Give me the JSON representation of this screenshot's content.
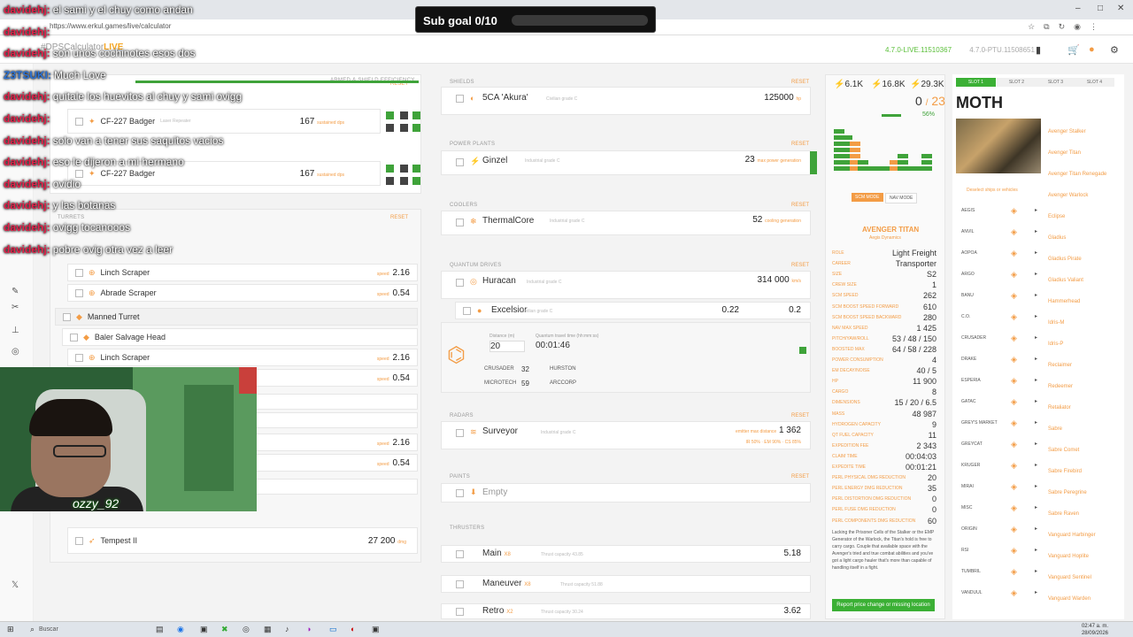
{
  "browser": {
    "url": "https://www.erkul.games/live/calculator",
    "window_controls": [
      "–",
      "□",
      "✕"
    ]
  },
  "site": {
    "logo_text": "#DPSCalculator",
    "logo_highlight": "LIVE",
    "live_label": "4.7.0-LIVE.11510367",
    "ptu_label": "4.7.0-PTU.11508651"
  },
  "subgoal": {
    "label": "Sub goal 0/10"
  },
  "chat": [
    {
      "user": "davidehj:",
      "msg": "el sami y el chuy como andan",
      "color": "red"
    },
    {
      "user": "davidehj:",
      "msg": "",
      "color": "red"
    },
    {
      "user": "davidehj:",
      "msg": "son unos cochinotes esos dos",
      "color": "red"
    },
    {
      "user": "Z3TSUKI:",
      "msg": "Much Love",
      "color": "blue"
    },
    {
      "user": "davidehj:",
      "msg": "quitale los huevitos al chuy y sami ovigg",
      "color": "red"
    },
    {
      "user": "davidehj:",
      "msg": "",
      "color": "red"
    },
    {
      "user": "davidehj:",
      "msg": "solo van a tener sus saquitos vacios",
      "color": "red"
    },
    {
      "user": "davidehj:",
      "msg": "eso le dijeron a mi hermano",
      "color": "red"
    },
    {
      "user": "davidehj:",
      "msg": "ovidio",
      "color": "red"
    },
    {
      "user": "davidehj:",
      "msg": "y las botanas",
      "color": "red"
    },
    {
      "user": "davidehj:",
      "msg": "ovigg tocanooos",
      "color": "red"
    },
    {
      "user": "davidehj:",
      "msg": "pobre ovig otra vez a leer",
      "color": "red"
    }
  ],
  "webcam": {
    "tag": "ozzy_92"
  },
  "weapons": {
    "header": "ARMED & SHIELD EFFICIENCY",
    "reset": "RESET",
    "rows": [
      {
        "name": "CF-227 Badger",
        "sub": "Laser Repeater",
        "value": "167",
        "unit": "sustained dps"
      },
      {
        "name": "CF-227 Badger",
        "sub": "",
        "value": "167",
        "unit": "sustained dps"
      }
    ]
  },
  "turrets": {
    "header": "TURRETS",
    "reset": "RESET",
    "rows": [
      {
        "name": "Linch Scraper",
        "value": "2.16",
        "unit": "speed"
      },
      {
        "name": "Abrade Scraper",
        "value": "0.54",
        "unit": "speed"
      },
      {
        "name": "Manned Turret",
        "value": "",
        "unit": ""
      },
      {
        "name": "Baler Salvage Head",
        "value": "",
        "unit": ""
      },
      {
        "name": "Linch Scraper",
        "value": "2.16",
        "unit": "speed"
      },
      {
        "name": "",
        "value": "0.54",
        "unit": "speed"
      },
      {
        "name": "",
        "value": "2.16",
        "unit": "speed"
      },
      {
        "name": "",
        "value": "0.54",
        "unit": "speed"
      },
      {
        "name": "Tempest II",
        "value": "27 200",
        "unit": "dmg"
      }
    ]
  },
  "shields": {
    "header": "SHIELDS",
    "reset": "RESET",
    "name": "5CA 'Akura'",
    "sub": "Civilian grade C",
    "value": "125000",
    "unit": "hp"
  },
  "power": {
    "header": "POWER PLANTS",
    "reset": "RESET",
    "name": "Ginzel",
    "sub": "Industrial grade C",
    "value": "23",
    "unit": "max power generation"
  },
  "coolers": {
    "header": "COOLERS",
    "reset": "RESET",
    "name": "ThermalCore",
    "sub": "Industrial grade C",
    "value": "52",
    "unit": "cooling generation"
  },
  "quantum": {
    "header": "QUANTUM DRIVES",
    "reset": "RESET",
    "name": "Huracan",
    "sub": "Industrial grade C",
    "value": "314 000",
    "unit": "km/s",
    "sub_name": "Excelsior",
    "sub_sub": "Civilian grade C",
    "sub_val1": "0.22",
    "sub_val2": "0.2",
    "distance_label": "Distance (m)",
    "distance": "20",
    "travel_label": "Quantum travel time (hh:mm:ss)",
    "travel": "00:01:46",
    "route": [
      {
        "from": "CRUSADER",
        "km": "32",
        "to": "HURSTON"
      },
      {
        "from": "MICROTECH",
        "km": "59",
        "to": "ARCCORP"
      }
    ]
  },
  "radars": {
    "header": "RADARS",
    "reset": "RESET",
    "name": "Surveyor",
    "sub": "Industrial grade C",
    "value": "1 362",
    "unit": "emitter max distance",
    "pcts": "IR 50% · EM 90% · CS 85%"
  },
  "paints": {
    "header": "PAINTS",
    "reset": "RESET",
    "name": "Empty"
  },
  "thrusters": {
    "header": "THRUSTERS",
    "rows": [
      {
        "name": "Main",
        "mult": "X8",
        "sub": "Thrust capacity 43.85",
        "value": "5.18"
      },
      {
        "name": "Maneuver",
        "mult": "X8",
        "sub": "Thrust capacity 51.88",
        "value": ""
      },
      {
        "name": "Retro",
        "mult": "X2",
        "sub": "Thrust capacity 30.24",
        "value": "3.62"
      }
    ]
  },
  "stats": {
    "top": [
      {
        "val": "6.1K"
      },
      {
        "val": "16.8K"
      },
      {
        "val": "29.3K"
      }
    ],
    "output": "0",
    "output_max": "23",
    "consumption_pct": "56",
    "mode_scm": "SCM MODE",
    "mode_nav": "NAV MODE",
    "ship_title": "AVENGER TITAN",
    "ship_sub": "Aegis Dynamics",
    "specs": [
      {
        "label": "ROLE",
        "value": "Light Freight"
      },
      {
        "label": "CAREER",
        "value": "Transporter"
      },
      {
        "label": "SIZE",
        "value": "S2"
      },
      {
        "label": "CREW SIZE",
        "value": "1"
      },
      {
        "label": "SCM SPEED",
        "value": "262"
      },
      {
        "label": "SCM BOOST SPEED FORWARD",
        "value": "610"
      },
      {
        "label": "SCM BOOST SPEED BACKWARD",
        "value": "280"
      },
      {
        "label": "NAV MAX SPEED",
        "value": "1 425"
      },
      {
        "label": "PITCH/YAW/ROLL",
        "value": "53 / 48 / 150"
      },
      {
        "label": "BOOSTED MAX",
        "value": "64 / 58 / 228"
      },
      {
        "label": "POWER CONSUMPTION",
        "value": "4"
      },
      {
        "label": "EM DECAY/NOISE",
        "value": "40 / 5"
      },
      {
        "label": "HP",
        "value": "11 900"
      },
      {
        "label": "CARGO",
        "value": "8"
      },
      {
        "label": "DIMENSIONS",
        "value": "15 / 20 / 6.5"
      },
      {
        "label": "MASS",
        "value": "48 987"
      },
      {
        "label": "HYDROGEN CAPACITY",
        "value": "9"
      },
      {
        "label": "QT FUEL CAPACITY",
        "value": "11"
      },
      {
        "label": "EXPEDITION FEE",
        "value": "2 343"
      },
      {
        "label": "CLAIM TIME",
        "value": "00:04:03"
      },
      {
        "label": "EXPEDITE TIME",
        "value": "00:01:21"
      },
      {
        "label": "PERL PHYSICAL DMG REDUCTION",
        "value": "20"
      },
      {
        "label": "PERL ENERGY DMG REDUCTION",
        "value": "35"
      },
      {
        "label": "PERL DISTORTION DMG REDUCTION",
        "value": "0"
      },
      {
        "label": "PERL FUSE DMG REDUCTION",
        "value": "0"
      },
      {
        "label": "PERL COMPONENTS DMG REDUCTION",
        "value": "60"
      }
    ],
    "desc": "Lacking the Prisoner Cells of the Stalker or the EMP Generator of the Warlock, the Titan's hold is free to carry cargo. Couple that available space with the Avenger's tried and true combat abilities and you've got a light cargo hauler that's more than capable of handling itself in a fight.",
    "report_btn": "Report price change or missing location"
  },
  "ship_panel": {
    "slots": [
      "SLOT 1",
      "SLOT 2",
      "SLOT 3",
      "SLOT 4"
    ],
    "name": "MOTH",
    "filter_hint": "Deselect ships or vehicles",
    "manufacturers": [
      "AEGIS",
      "ANVIL",
      "AOPOA",
      "ARGO",
      "BANU",
      "C.O.",
      "CRUSADER",
      "DRAKE",
      "ESPERIA",
      "GATAC",
      "GREY'S MARKET",
      "GREYCAT",
      "KRUGER",
      "MIRAI",
      "MISC",
      "ORIGIN",
      "RSI",
      "TUMBRIL",
      "VANDUUL"
    ],
    "ships": [
      "Avenger Stalker",
      "Avenger Titan",
      "Avenger Titan Renegade",
      "Avenger Warlock",
      "Eclipse",
      "Gladius",
      "Gladius Pirate",
      "Gladius Valiant",
      "Hammerhead",
      "Idris-M",
      "Idris-P",
      "Reclaimer",
      "Redeemer",
      "Retaliator",
      "Sabre",
      "Sabre Comet",
      "Sabre Firebird",
      "Sabre Peregrine",
      "Sabre Raven",
      "Vanguard Harbinger",
      "Vanguard Hoplite",
      "Vanguard Sentinel",
      "Vanguard Warden"
    ]
  },
  "taskbar": {
    "search": "Buscar",
    "time": "02:47 a. m.",
    "date": "28/09/2026"
  }
}
